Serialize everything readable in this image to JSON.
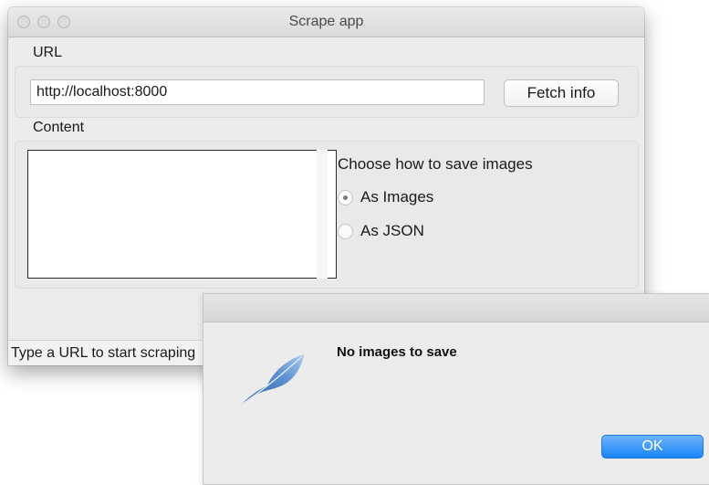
{
  "window": {
    "title": "Scrape app"
  },
  "url_group": {
    "label": "URL",
    "input_value": "http://localhost:8000",
    "fetch_button_label": "Fetch info"
  },
  "content_group": {
    "label": "Content",
    "save_prompt": "Choose how to save images",
    "options": [
      {
        "label": "As Images",
        "checked": true
      },
      {
        "label": "As JSON",
        "checked": false
      }
    ]
  },
  "status_bar": {
    "text": "Type a URL to start scraping"
  },
  "dialog": {
    "icon": "feather-icon",
    "message": "No images to save",
    "ok_label": "OK"
  },
  "colors": {
    "ok_button": "#1a84f7",
    "window_bg": "#ececec"
  }
}
